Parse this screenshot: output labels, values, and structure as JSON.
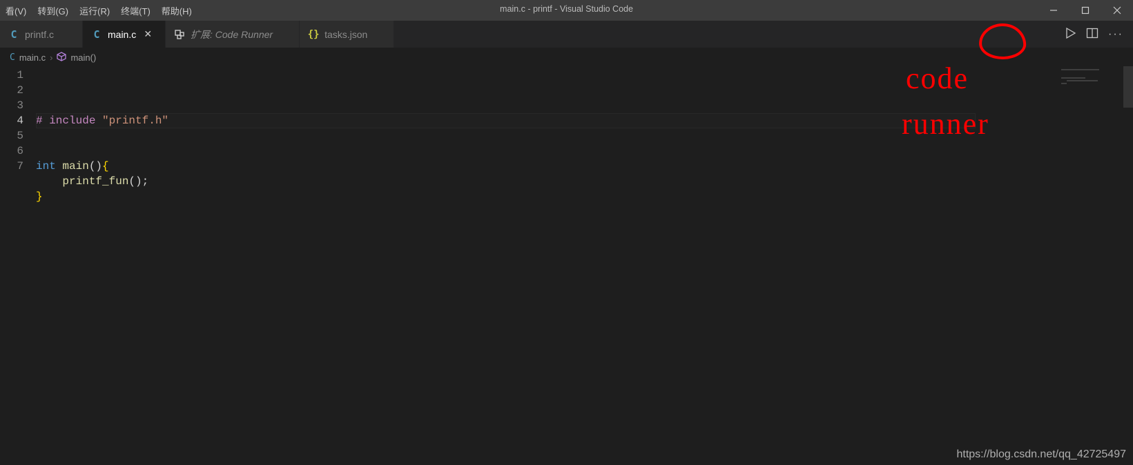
{
  "menu": {
    "items": [
      {
        "label": "看(V)"
      },
      {
        "label": "转到(G)"
      },
      {
        "label": "运行(R)"
      },
      {
        "label": "终端(T)"
      },
      {
        "label": "帮助(H)"
      }
    ]
  },
  "window": {
    "title": "main.c - printf - Visual Studio Code"
  },
  "tabs": [
    {
      "icon": "c",
      "label": "printf.c",
      "active": false,
      "italic": false
    },
    {
      "icon": "c",
      "label": "main.c",
      "active": true,
      "italic": false
    },
    {
      "icon": "ext",
      "label": "扩展: Code Runner",
      "active": false,
      "italic": true
    },
    {
      "icon": "json",
      "label": "tasks.json",
      "active": false,
      "italic": false
    }
  ],
  "breadcrumbs": {
    "file_icon": "c",
    "file": "main.c",
    "symbol_icon": "cube",
    "symbol": "main()"
  },
  "editor": {
    "current_line": 4,
    "lines": [
      {
        "n": 1,
        "segments": [
          {
            "cls": "dir1",
            "text": "# include "
          },
          {
            "cls": "tok-str",
            "text": "\"printf.h\""
          }
        ]
      },
      {
        "n": 2,
        "segments": []
      },
      {
        "n": 3,
        "segments": []
      },
      {
        "n": 4,
        "segments": [
          {
            "cls": "tok-kw",
            "text": "int "
          },
          {
            "cls": "tok-fn",
            "text": "main"
          },
          {
            "cls": "tok-pun",
            "text": "()"
          },
          {
            "cls": "tok-brace",
            "text": "{"
          }
        ]
      },
      {
        "n": 5,
        "segments": [
          {
            "cls": "tok-pun",
            "text": "    "
          },
          {
            "cls": "tok-fn",
            "text": "printf_fun"
          },
          {
            "cls": "tok-pun",
            "text": "();"
          }
        ]
      },
      {
        "n": 6,
        "segments": [
          {
            "cls": "tok-brace",
            "text": "}"
          }
        ]
      },
      {
        "n": 7,
        "segments": []
      }
    ]
  },
  "tab_actions": {
    "run_icon": "play",
    "split_icon": "split",
    "more_icon": "ellipsis"
  },
  "annotations": {
    "line1": "code",
    "line2": "runner"
  },
  "watermark": "https://blog.csdn.net/qq_42725497"
}
